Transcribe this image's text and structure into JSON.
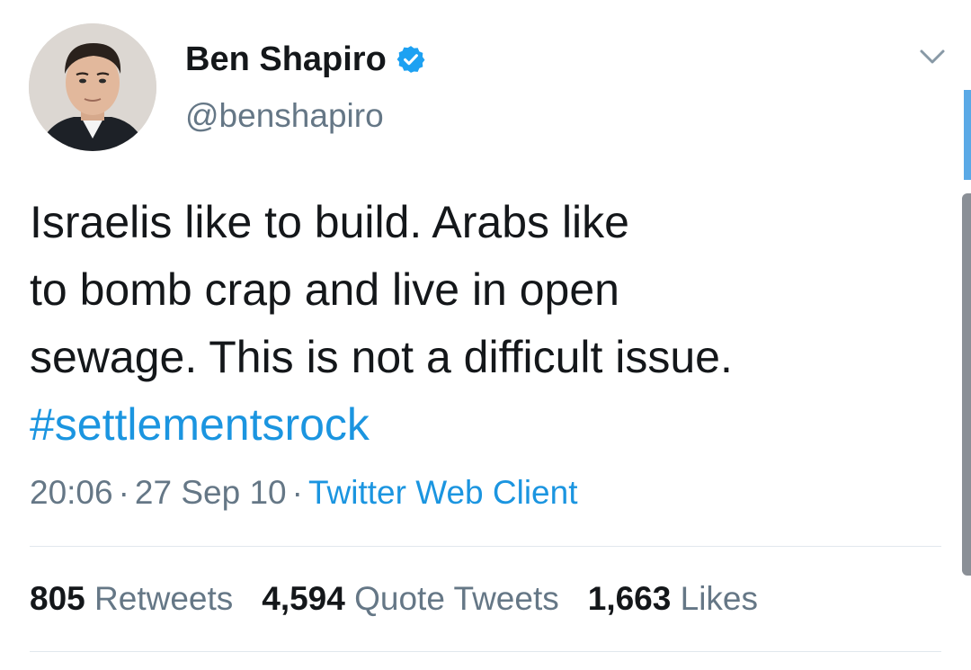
{
  "author": {
    "display_name": "Ben Shapiro",
    "handle": "@benshapiro",
    "verified": true
  },
  "tweet": {
    "lines": [
      "Israelis like to build. Arabs like",
      "to bomb crap and live in open",
      "sewage. This is not a difficult issue."
    ],
    "hashtag": "#settlementsrock"
  },
  "meta": {
    "time": "20:06",
    "separator": "·",
    "date": "27 Sep 10",
    "client": "Twitter Web Client"
  },
  "stats": {
    "retweets_count": "805",
    "retweets_label": "Retweets",
    "quotes_count": "4,594",
    "quotes_label": "Quote Tweets",
    "likes_count": "1,663",
    "likes_label": "Likes"
  },
  "colors": {
    "link": "#1b95e0",
    "secondary_text": "#657786",
    "divider": "#e1e8ed"
  },
  "icons": {
    "verified": "verified-badge-icon",
    "menu": "chevron-down-icon"
  }
}
